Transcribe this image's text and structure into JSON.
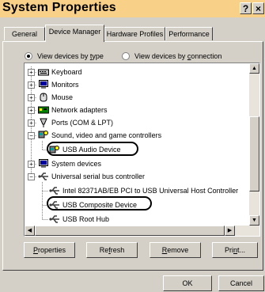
{
  "window": {
    "title": "System Properties",
    "help_button": "?",
    "close_button": "×"
  },
  "tabs": [
    {
      "label": "General"
    },
    {
      "label": "Device Manager",
      "active": true
    },
    {
      "label": "Hardware Profiles"
    },
    {
      "label": "Performance"
    }
  ],
  "view_options": {
    "by_type": {
      "label": "View devices by type",
      "pre": "View devices by ",
      "key": "t",
      "post": "ype",
      "selected": true
    },
    "by_connection": {
      "label": "View devices by connection",
      "pre": "View devices by ",
      "key": "c",
      "post": "onnection",
      "selected": false
    }
  },
  "tree": {
    "items": [
      {
        "label": "Keyboard",
        "icon": "keyboard-icon",
        "expander": "+"
      },
      {
        "label": "Monitors",
        "icon": "monitor-icon",
        "expander": "+"
      },
      {
        "label": "Mouse",
        "icon": "mouse-icon",
        "expander": "+"
      },
      {
        "label": "Network adapters",
        "icon": "network-adapter-icon",
        "expander": "+"
      },
      {
        "label": "Ports (COM & LPT)",
        "icon": "port-icon",
        "expander": "+"
      },
      {
        "label": "Sound, video and game controllers",
        "icon": "sound-icon",
        "expander": "−"
      },
      {
        "label": "USB Audio Device",
        "icon": "sound-device-icon",
        "selected": true
      },
      {
        "label": "System devices",
        "icon": "system-device-icon",
        "expander": "+"
      },
      {
        "label": "Universal serial bus controller",
        "icon": "usb-icon",
        "expander": "−"
      },
      {
        "label": "Intel 82371AB/EB PCI to USB Universal Host Controller",
        "icon": "usb-icon"
      },
      {
        "label": "USB Composite Device",
        "icon": "usb-icon"
      },
      {
        "label": "USB Root Hub",
        "icon": "usb-icon"
      }
    ]
  },
  "buttons": {
    "properties": {
      "pre": "",
      "key": "P",
      "post": "roperties"
    },
    "refresh": {
      "pre": "Re",
      "key": "f",
      "post": "resh"
    },
    "remove": {
      "pre": "",
      "key": "R",
      "post": "emove"
    },
    "print": {
      "pre": "Pri",
      "key": "n",
      "post": "t..."
    },
    "ok": "OK",
    "cancel": "Cancel"
  },
  "colors": {
    "title_bar": "#f8d088",
    "dialog_face": "#d4d0c8",
    "list_background": "#ffffff"
  }
}
